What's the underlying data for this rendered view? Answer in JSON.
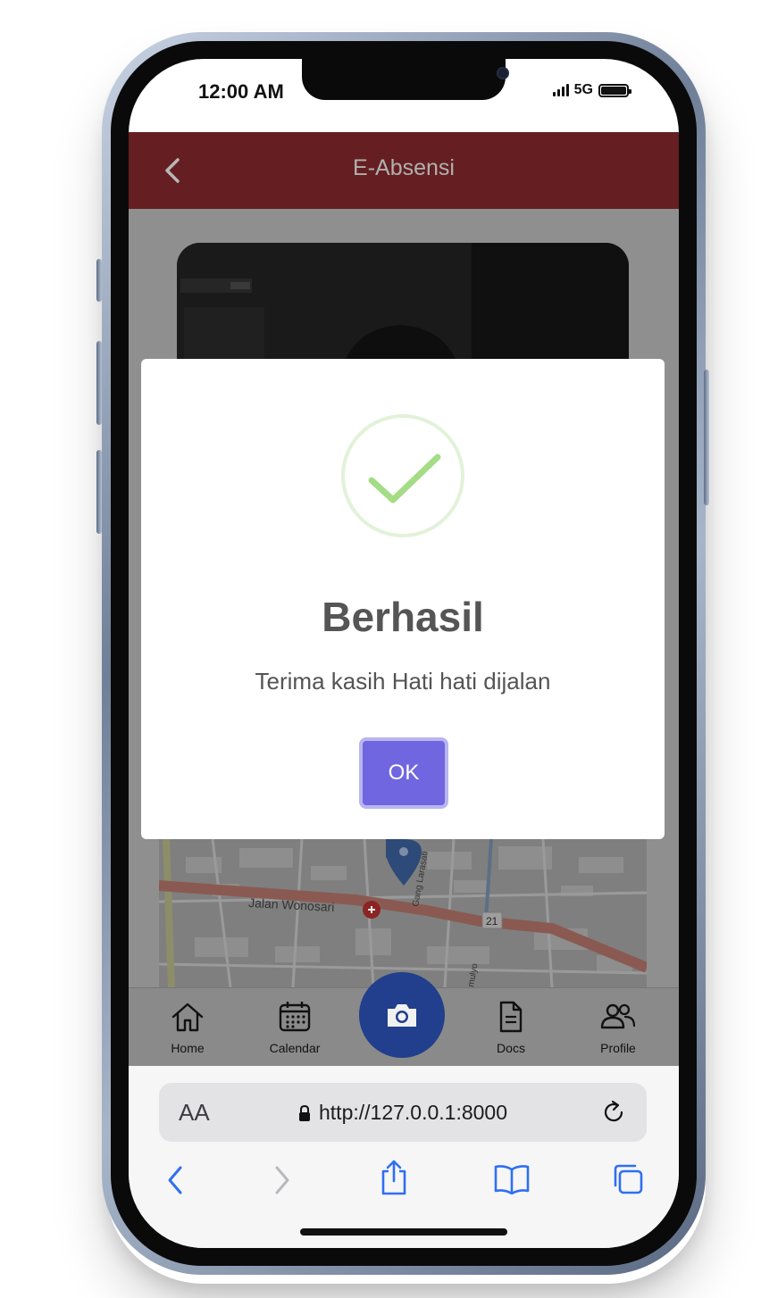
{
  "status_bar": {
    "time": "12:00 AM",
    "network": "5G"
  },
  "app_bar": {
    "title": "E-Absensi"
  },
  "map": {
    "street_label": "Jalan Wonosari",
    "route_number": "21",
    "road_side_label": "Gang Larasati",
    "road_side_label_2": "mulyo"
  },
  "bottom_nav": {
    "items": [
      {
        "label": "Home",
        "icon": "home-icon"
      },
      {
        "label": "Calendar",
        "icon": "calendar-icon"
      },
      {
        "label": "",
        "icon": "camera-icon"
      },
      {
        "label": "Docs",
        "icon": "document-icon"
      },
      {
        "label": "Profile",
        "icon": "users-icon"
      }
    ]
  },
  "dialog": {
    "title": "Berhasil",
    "message": "Terima kasih Hati hati dijalan",
    "ok_label": "OK"
  },
  "browser": {
    "text_size_label": "AA",
    "url": "http://127.0.0.1:8000"
  },
  "colors": {
    "app_bar": "#651f22",
    "fab": "#213f8c",
    "ok_button": "#7066e0",
    "browser_blue": "#2f6ff0",
    "success_check": "#a5dc86"
  }
}
